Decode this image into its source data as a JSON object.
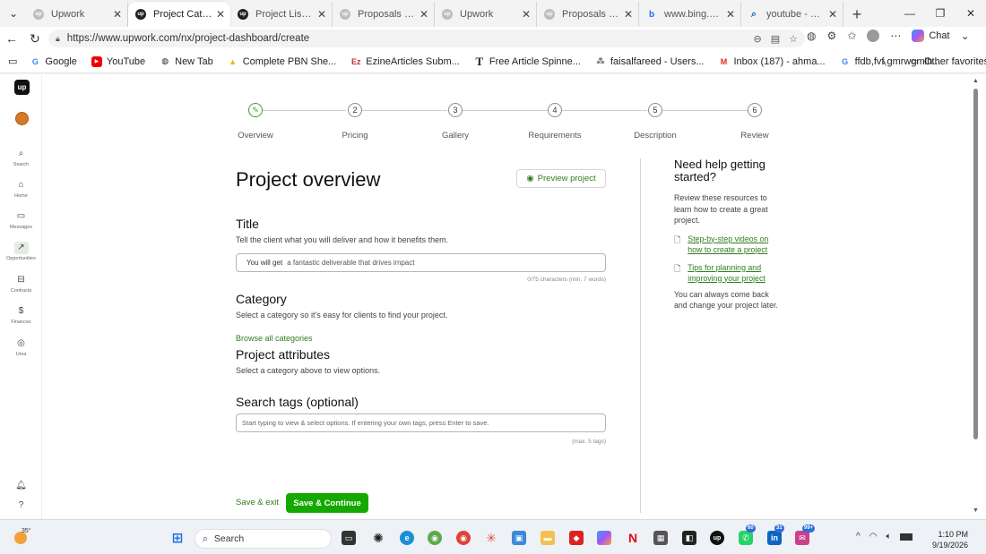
{
  "browser": {
    "tabs": [
      {
        "label": "Upwork",
        "active": false
      },
      {
        "label": "Project Catalog | Upwork",
        "active": true
      },
      {
        "label": "Project List | Upwork",
        "active": false
      },
      {
        "label": "Proposals and offers",
        "active": false
      },
      {
        "label": "Upwork",
        "active": false
      },
      {
        "label": "Proposals and offers",
        "active": false
      },
      {
        "label": "www.bing.com",
        "active": false
      },
      {
        "label": "youtube - Search",
        "active": false
      }
    ],
    "url": "https://www.upwork.com/nx/project-dashboard/create",
    "chat_label": "Chat",
    "bookmarks": [
      "Google",
      "YouTube",
      "New Tab",
      "Complete PBN She...",
      "EzineArticles Subm...",
      "Free Article Spinne...",
      "faisalfareed - Users...",
      "Inbox (187) - ahma...",
      "ffdb,fvf,gmrwgmlh..."
    ],
    "other_favorites": "Other favorites"
  },
  "sidebar": {
    "logo": "up",
    "items": [
      {
        "label": "Search",
        "icon": "search-icon"
      },
      {
        "label": "Home",
        "icon": "home-icon"
      },
      {
        "label": "Messages",
        "icon": "messages-icon"
      },
      {
        "label": "Opportunities",
        "icon": "opportunities-icon",
        "active": true
      },
      {
        "label": "Contracts",
        "icon": "contracts-icon"
      },
      {
        "label": "Finances",
        "icon": "finances-icon"
      },
      {
        "label": "Uma",
        "icon": "uma-icon"
      }
    ]
  },
  "steps": [
    {
      "num": "✎",
      "label": "Overview",
      "done": true
    },
    {
      "num": "2",
      "label": "Pricing"
    },
    {
      "num": "3",
      "label": "Gallery"
    },
    {
      "num": "4",
      "label": "Requirements"
    },
    {
      "num": "5",
      "label": "Description"
    },
    {
      "num": "6",
      "label": "Review"
    }
  ],
  "page": {
    "title": "Project overview",
    "preview_label": "Preview project",
    "title_section": {
      "heading": "Title",
      "desc": "Tell the client what you will deliver and how it benefits them.",
      "prefix": "You will get",
      "placeholder": "a fantastic deliverable that drives impact",
      "count": "0/75 characters (min. 7 words)"
    },
    "category": {
      "heading": "Category",
      "desc": "Select a category so it's easy for clients to find your project.",
      "browse": "Browse all categories"
    },
    "attributes": {
      "heading": "Project attributes",
      "desc": "Select a category above to view options."
    },
    "tags": {
      "heading": "Search tags (optional)",
      "placeholder": "Start typing to view & select options. If entering your own tags, press Enter to save.",
      "max": "(max. 5 tags)"
    },
    "save_exit": "Save & exit",
    "save_continue": "Save & Continue"
  },
  "help": {
    "title": "Need help getting started?",
    "intro": "Review these resources to learn how to create a great project.",
    "links": [
      "Step-by-step videos on how to create a project",
      "Tips for planning and improving your project"
    ],
    "outro": "You can always come back and change your project later."
  },
  "taskbar": {
    "weather_temp": "35°",
    "search_label": "Search",
    "time": "1:10 PM",
    "date": "9/19/2026",
    "badges": {
      "whatsapp": "60",
      "linkedin": "31",
      "mail": "99+"
    }
  }
}
